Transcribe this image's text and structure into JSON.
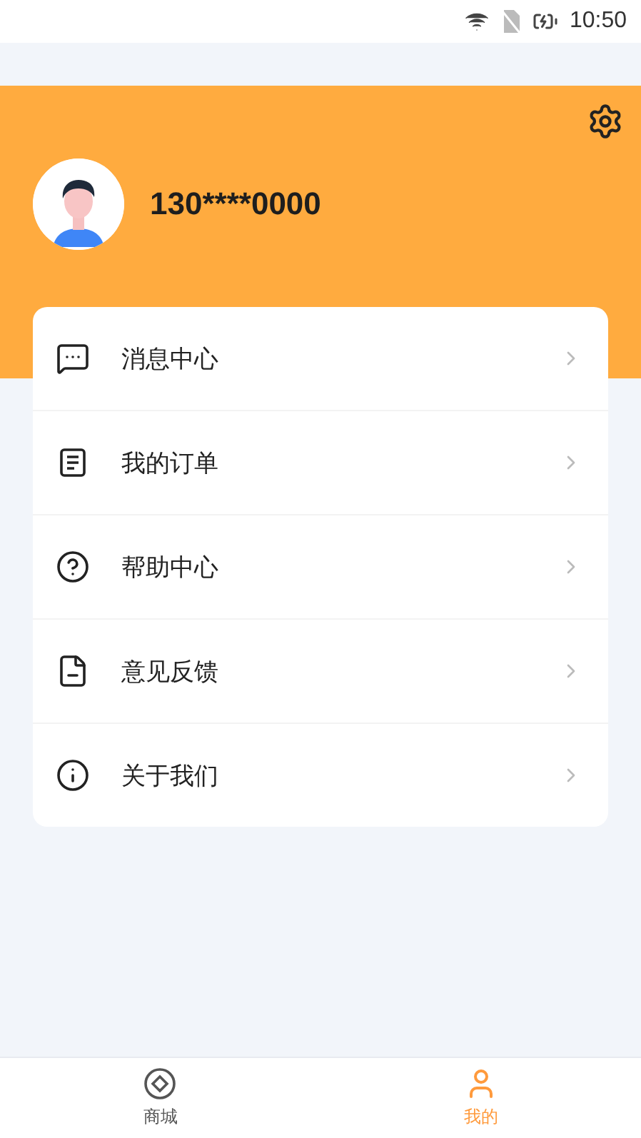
{
  "status_bar": {
    "time": "10:50"
  },
  "profile": {
    "phone": "130****0000"
  },
  "menu": [
    {
      "label": "消息中心"
    },
    {
      "label": "我的订单"
    },
    {
      "label": "帮助中心"
    },
    {
      "label": "意见反馈"
    },
    {
      "label": "关于我们"
    }
  ],
  "bottom_nav": [
    {
      "label": "商城",
      "selected": false
    },
    {
      "label": "我的",
      "selected": true
    }
  ]
}
